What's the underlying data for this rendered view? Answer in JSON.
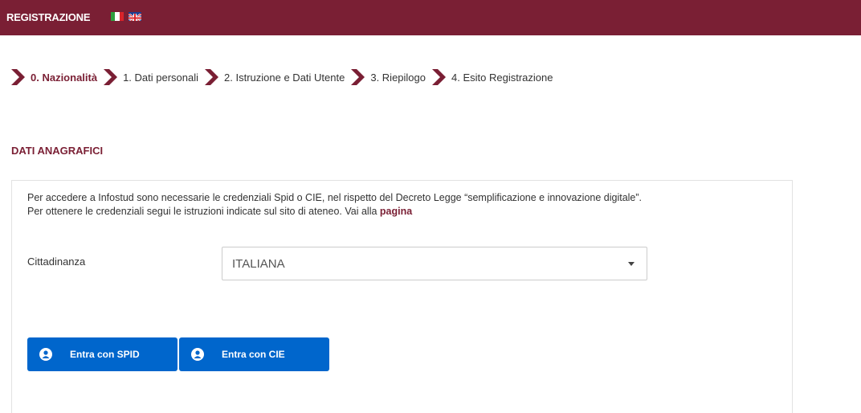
{
  "header": {
    "title": "REGISTRAZIONE",
    "flags": [
      "italian-flag",
      "uk-flag"
    ],
    "background_color": "#7a1f34"
  },
  "steps": [
    {
      "label": "0. Nazionalità",
      "active": true
    },
    {
      "label": "1. Dati personali",
      "active": false
    },
    {
      "label": "2. Istruzione e Dati Utente",
      "active": false
    },
    {
      "label": "3. Riepilogo",
      "active": false
    },
    {
      "label": "4. Esito Registrazione",
      "active": false
    }
  ],
  "section": {
    "title": "DATI ANAGRAFICI",
    "info_line1": "Per accedere a Infostud sono necessarie le credenziali Spid o CIE, nel rispetto del Decreto Legge “semplificazione e innovazione digitale”.",
    "info_line2_prefix": "Per ottenere le credenziali segui le istruzioni indicate sul sito di ateneo. Vai alla",
    "info_link": "pagina"
  },
  "cittadinanza": {
    "label": "Cittadinanza",
    "selected": "ITALIANA"
  },
  "buttons": {
    "spid_label": "Entra con SPID",
    "cie_label": "Entra con CIE",
    "color": "#0066cc"
  }
}
